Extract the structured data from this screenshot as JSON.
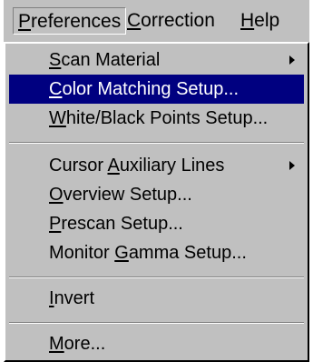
{
  "menubar": {
    "items": [
      {
        "pre": "",
        "key": "P",
        "post": "references",
        "active": true
      },
      {
        "pre": "",
        "key": "C",
        "post": "orrection",
        "active": false
      },
      {
        "pre": "",
        "key": "H",
        "post": "elp",
        "active": false
      }
    ]
  },
  "menu": {
    "items": [
      {
        "pre": "",
        "key": "S",
        "post": "can Material",
        "submenu": true
      },
      {
        "pre": "",
        "key": "C",
        "post": "olor Matching Setup...",
        "selected": true
      },
      {
        "pre": "",
        "key": "W",
        "post": "hite/Black Points Setup..."
      },
      {
        "pre": "Cursor ",
        "key": "A",
        "post": "uxiliary Lines",
        "submenu": true
      },
      {
        "pre": "",
        "key": "O",
        "post": "verview Setup..."
      },
      {
        "pre": "",
        "key": "P",
        "post": "rescan Setup..."
      },
      {
        "pre": "Monitor ",
        "key": "G",
        "post": "amma Setup..."
      },
      {
        "pre": "",
        "key": "I",
        "post": "nvert"
      },
      {
        "pre": "",
        "key": "M",
        "post": "ore..."
      }
    ]
  },
  "colors": {
    "menu_bg": "#c0c0c0",
    "highlight": "#000080",
    "highlight_text": "#ffffff"
  },
  "icons": {
    "submenu": "submenu-arrow-icon"
  }
}
